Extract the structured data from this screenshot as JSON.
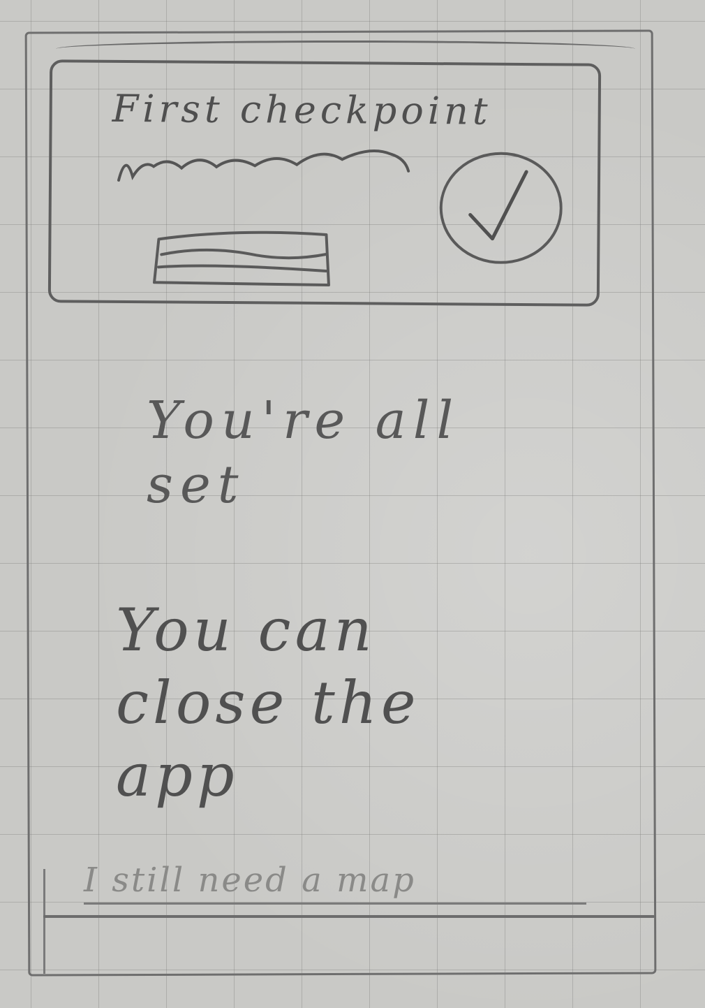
{
  "checkpoint_card": {
    "title": "First checkpoint",
    "status_icon": "check-circle-icon"
  },
  "message": {
    "all_set": "You're all\nset",
    "close_app": "You can\nclose the\napp"
  },
  "map_link": {
    "label": "I still need a map"
  },
  "colors": {
    "paper": "#c9c9c6",
    "pencil": "#5c5c5c",
    "grid": "#787876"
  }
}
